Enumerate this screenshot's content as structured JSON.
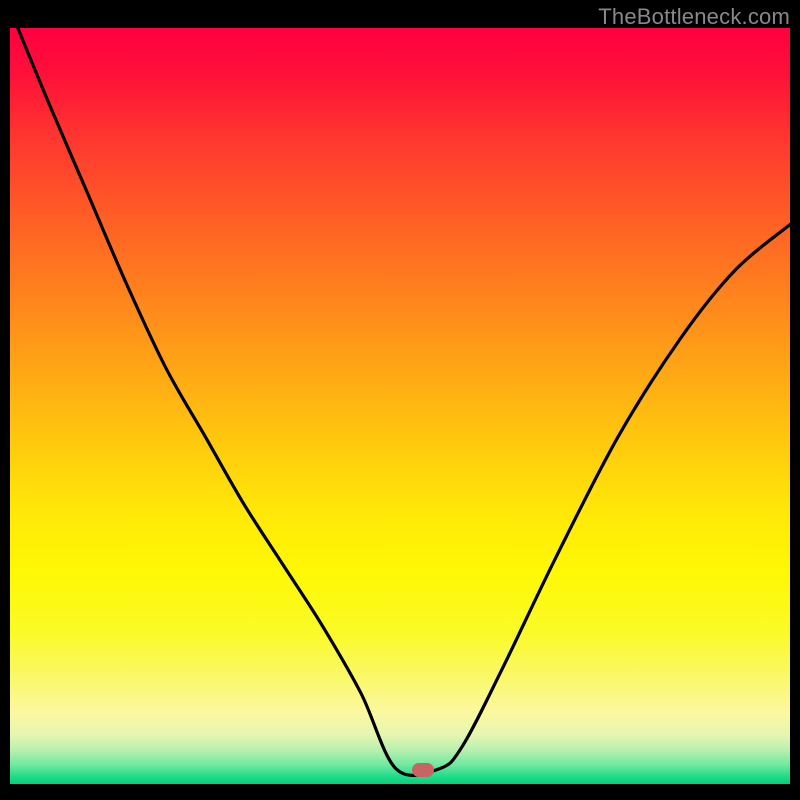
{
  "watermark": "TheBottleneck.com",
  "gradient_stops": [
    {
      "offset": 0.0,
      "color": "#ff0040"
    },
    {
      "offset": 0.06,
      "color": "#ff103a"
    },
    {
      "offset": 0.14,
      "color": "#ff3430"
    },
    {
      "offset": 0.24,
      "color": "#ff5a26"
    },
    {
      "offset": 0.34,
      "color": "#ff7e1e"
    },
    {
      "offset": 0.44,
      "color": "#ffa216"
    },
    {
      "offset": 0.54,
      "color": "#ffc60e"
    },
    {
      "offset": 0.64,
      "color": "#ffe808"
    },
    {
      "offset": 0.72,
      "color": "#fff804"
    },
    {
      "offset": 0.8,
      "color": "#fafa28"
    },
    {
      "offset": 0.86,
      "color": "#faf86a"
    },
    {
      "offset": 0.905,
      "color": "#fcf8a0"
    },
    {
      "offset": 0.935,
      "color": "#e6f6b0"
    },
    {
      "offset": 0.955,
      "color": "#b8f0b0"
    },
    {
      "offset": 0.975,
      "color": "#70e8a0"
    },
    {
      "offset": 0.99,
      "color": "#20dc88"
    },
    {
      "offset": 1.0,
      "color": "#00d47c"
    }
  ],
  "marker": {
    "x_frac": 0.53,
    "y_frac": 0.982,
    "color": "#c86464"
  },
  "chart_data": {
    "type": "line",
    "title": "",
    "xlabel": "",
    "ylabel": "",
    "xlim": [
      0,
      1
    ],
    "ylim": [
      0,
      1
    ],
    "series": [
      {
        "name": "bottleneck-curve",
        "x": [
          0.01,
          0.05,
          0.1,
          0.15,
          0.2,
          0.25,
          0.3,
          0.35,
          0.4,
          0.45,
          0.495,
          0.55,
          0.58,
          0.63,
          0.7,
          0.78,
          0.86,
          0.93,
          1.0
        ],
        "y": [
          1.0,
          0.9,
          0.78,
          0.66,
          0.55,
          0.46,
          0.37,
          0.29,
          0.21,
          0.12,
          0.02,
          0.02,
          0.05,
          0.15,
          0.3,
          0.46,
          0.59,
          0.68,
          0.74
        ]
      }
    ],
    "annotations": [
      {
        "type": "marker",
        "x": 0.53,
        "y": 0.018,
        "label": "optimal-point"
      }
    ]
  }
}
